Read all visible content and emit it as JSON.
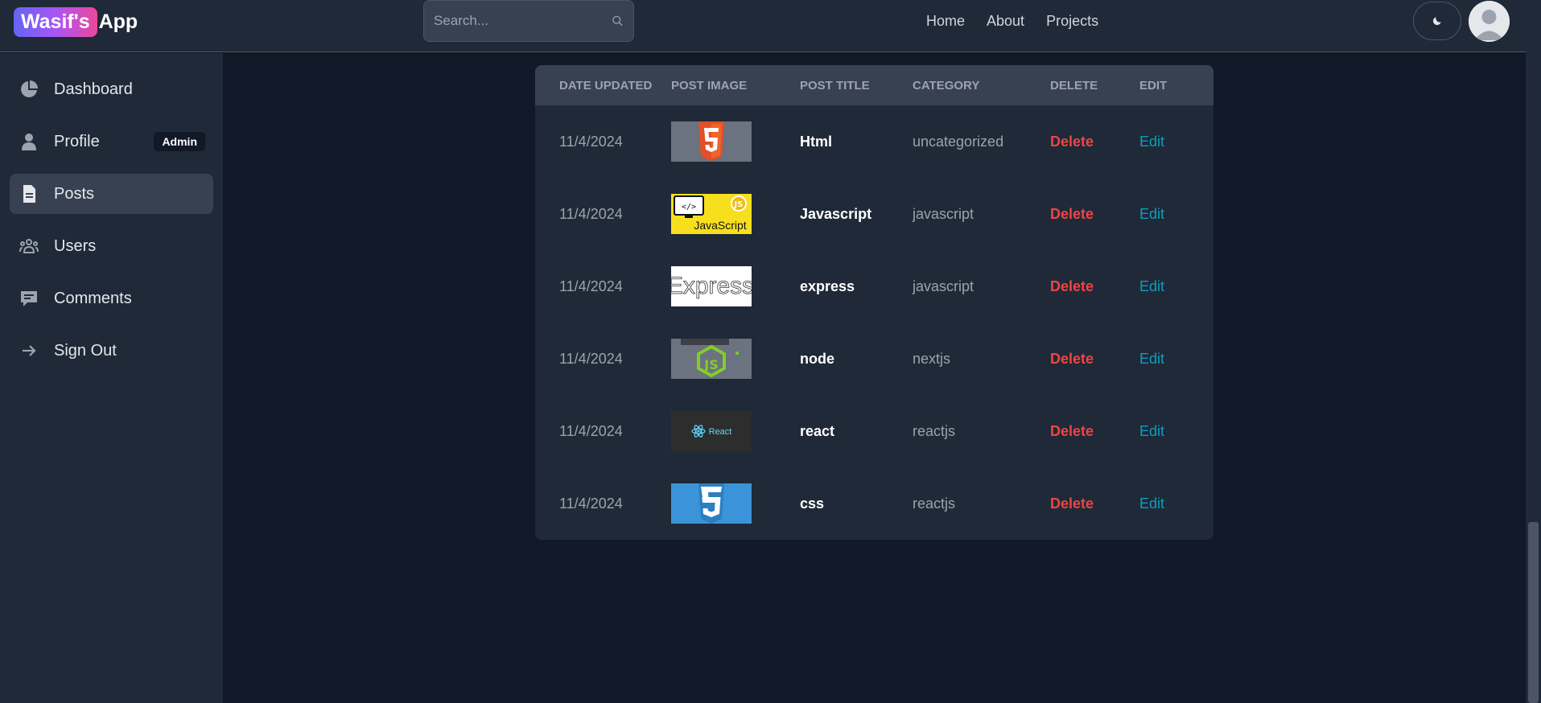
{
  "header": {
    "logo_badge": "Wasif's",
    "logo_rest": "App",
    "search_placeholder": "Search...",
    "nav": [
      "Home",
      "About",
      "Projects"
    ]
  },
  "sidebar": {
    "items": [
      {
        "label": "Dashboard",
        "icon": "pie-chart-icon"
      },
      {
        "label": "Profile",
        "icon": "user-icon",
        "badge": "Admin"
      },
      {
        "label": "Posts",
        "icon": "document-icon",
        "active": true
      },
      {
        "label": "Users",
        "icon": "users-group-icon"
      },
      {
        "label": "Comments",
        "icon": "comment-icon"
      },
      {
        "label": "Sign Out",
        "icon": "arrow-right-icon"
      }
    ]
  },
  "table": {
    "headers": [
      "DATE UPDATED",
      "POST IMAGE",
      "POST TITLE",
      "CATEGORY",
      "DELETE",
      "EDIT"
    ],
    "rows": [
      {
        "date": "11/4/2024",
        "image": "html5-logo",
        "title": "Html",
        "category": "uncategorized",
        "delete": "Delete",
        "edit": "Edit"
      },
      {
        "date": "11/4/2024",
        "image": "javascript-logo",
        "title": "Javascript",
        "category": "javascript",
        "delete": "Delete",
        "edit": "Edit"
      },
      {
        "date": "11/4/2024",
        "image": "express-logo",
        "title": "express",
        "category": "javascript",
        "delete": "Delete",
        "edit": "Edit"
      },
      {
        "date": "11/4/2024",
        "image": "nodejs-logo",
        "title": "node",
        "category": "nextjs",
        "delete": "Delete",
        "edit": "Edit"
      },
      {
        "date": "11/4/2024",
        "image": "react-logo",
        "title": "react",
        "category": "reactjs",
        "delete": "Delete",
        "edit": "Edit"
      },
      {
        "date": "11/4/2024",
        "image": "css3-logo",
        "title": "css",
        "category": "reactjs",
        "delete": "Delete",
        "edit": "Edit"
      }
    ],
    "image_text": {
      "javascript": "JavaScript",
      "javascript_tag": "</>",
      "express": "Express",
      "react": "React"
    }
  },
  "colors": {
    "background": "#111827",
    "panel": "#1f2937",
    "delete": "#ef4444",
    "edit": "#0e9fbf"
  }
}
